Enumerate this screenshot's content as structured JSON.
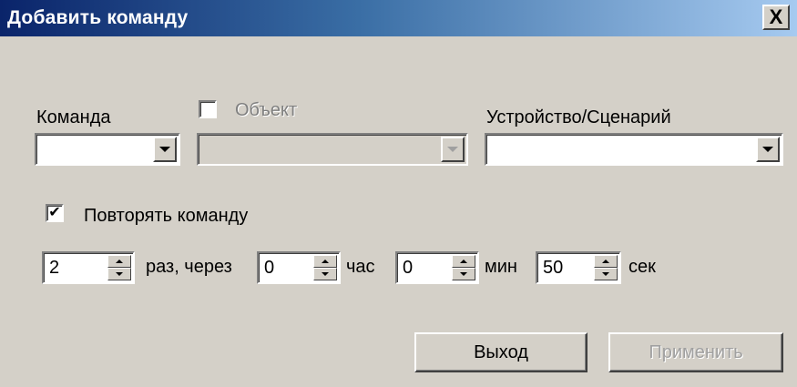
{
  "window": {
    "title": "Добавить команду",
    "close_label": "X"
  },
  "command": {
    "label": "Команда",
    "value": ""
  },
  "object": {
    "label": "Объект",
    "checked": false,
    "value": ""
  },
  "device": {
    "label": "Устройство/Сценарий",
    "value": ""
  },
  "repeat": {
    "label": "Повторять команду",
    "checked": true,
    "check_glyph": "✔",
    "times_value": "2",
    "times_label": "раз, через",
    "hours_value": "0",
    "hours_label": "час",
    "minutes_value": "0",
    "minutes_label": "мин",
    "seconds_value": "50",
    "seconds_label": "сек"
  },
  "buttons": {
    "exit_label": "Выход",
    "apply_label": "Применить"
  }
}
